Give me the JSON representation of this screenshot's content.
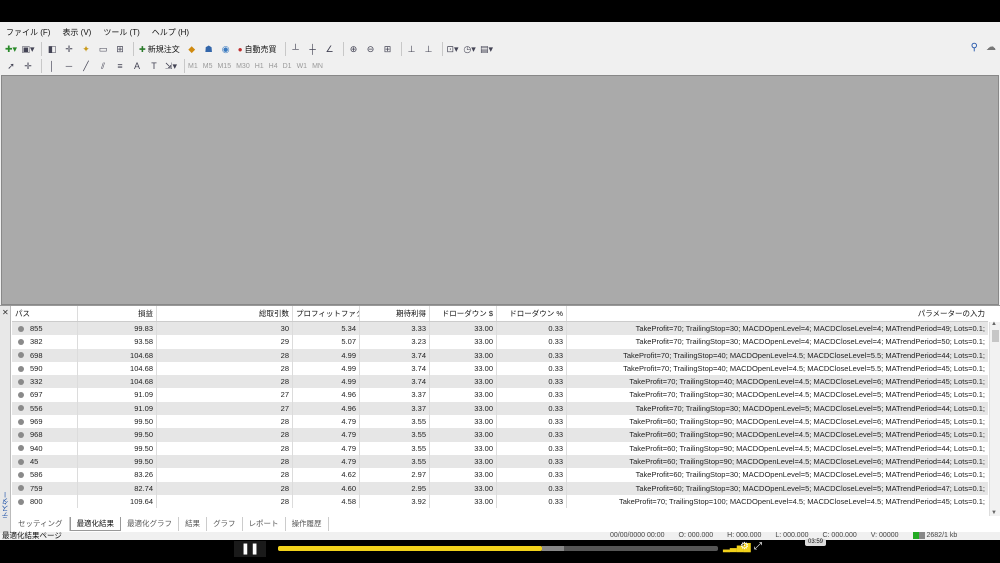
{
  "menu": [
    "ファイル (F)",
    "表示 (V)",
    "ツール (T)",
    "ヘルプ (H)"
  ],
  "toolbar": {
    "new_order": "新規注文",
    "auto_trade": "自動売買",
    "timeframes": [
      "M1",
      "M5",
      "M15",
      "M30",
      "H1",
      "H4",
      "D1",
      "W1",
      "MN"
    ]
  },
  "table": {
    "headers": {
      "pass": "パス",
      "profit": "損益",
      "trades": "総取引数",
      "pf": "プロフィットファク...",
      "ep": "期待利得",
      "dd": "ドローダウン $",
      "ddp": "ドローダウン %",
      "inputs": "パラメーターの入力"
    },
    "rows": [
      {
        "pass": "855",
        "profit": "99.83",
        "trades": "30",
        "pf": "5.34",
        "ep": "3.33",
        "dd": "33.00",
        "ddp": "0.33",
        "inputs": "TakeProfit=70; TrailingStop=30; MACDOpenLevel=4; MACDCloseLevel=4; MATrendPeriod=49; Lots=0.1;"
      },
      {
        "pass": "382",
        "profit": "93.58",
        "trades": "29",
        "pf": "5.07",
        "ep": "3.23",
        "dd": "33.00",
        "ddp": "0.33",
        "inputs": "TakeProfit=70; TrailingStop=30; MACDOpenLevel=4; MACDCloseLevel=4; MATrendPeriod=50; Lots=0.1;"
      },
      {
        "pass": "698",
        "profit": "104.68",
        "trades": "28",
        "pf": "4.99",
        "ep": "3.74",
        "dd": "33.00",
        "ddp": "0.33",
        "inputs": "TakeProfit=70; TrailingStop=40; MACDOpenLevel=4.5; MACDCloseLevel=5.5; MATrendPeriod=44; Lots=0.1;"
      },
      {
        "pass": "590",
        "profit": "104.68",
        "trades": "28",
        "pf": "4.99",
        "ep": "3.74",
        "dd": "33.00",
        "ddp": "0.33",
        "inputs": "TakeProfit=70; TrailingStop=40; MACDOpenLevel=4.5; MACDCloseLevel=5.5; MATrendPeriod=45; Lots=0.1;"
      },
      {
        "pass": "332",
        "profit": "104.68",
        "trades": "28",
        "pf": "4.99",
        "ep": "3.74",
        "dd": "33.00",
        "ddp": "0.33",
        "inputs": "TakeProfit=70; TrailingStop=40; MACDOpenLevel=4.5; MACDCloseLevel=6; MATrendPeriod=45; Lots=0.1;"
      },
      {
        "pass": "697",
        "profit": "91.09",
        "trades": "27",
        "pf": "4.96",
        "ep": "3.37",
        "dd": "33.00",
        "ddp": "0.33",
        "inputs": "TakeProfit=70; TrailingStop=30; MACDOpenLevel=4.5; MACDCloseLevel=5; MATrendPeriod=45; Lots=0.1;"
      },
      {
        "pass": "556",
        "profit": "91.09",
        "trades": "27",
        "pf": "4.96",
        "ep": "3.37",
        "dd": "33.00",
        "ddp": "0.33",
        "inputs": "TakeProfit=70; TrailingStop=30; MACDOpenLevel=5; MACDCloseLevel=5; MATrendPeriod=44; Lots=0.1;"
      },
      {
        "pass": "969",
        "profit": "99.50",
        "trades": "28",
        "pf": "4.79",
        "ep": "3.55",
        "dd": "33.00",
        "ddp": "0.33",
        "inputs": "TakeProfit=60; TrailingStop=90; MACDOpenLevel=4.5; MACDCloseLevel=6; MATrendPeriod=45; Lots=0.1;"
      },
      {
        "pass": "968",
        "profit": "99.50",
        "trades": "28",
        "pf": "4.79",
        "ep": "3.55",
        "dd": "33.00",
        "ddp": "0.33",
        "inputs": "TakeProfit=60; TrailingStop=90; MACDOpenLevel=4.5; MACDCloseLevel=5; MATrendPeriod=45; Lots=0.1;"
      },
      {
        "pass": "940",
        "profit": "99.50",
        "trades": "28",
        "pf": "4.79",
        "ep": "3.55",
        "dd": "33.00",
        "ddp": "0.33",
        "inputs": "TakeProfit=60; TrailingStop=90; MACDOpenLevel=4.5; MACDCloseLevel=5; MATrendPeriod=44; Lots=0.1;"
      },
      {
        "pass": "45",
        "profit": "99.50",
        "trades": "28",
        "pf": "4.79",
        "ep": "3.55",
        "dd": "33.00",
        "ddp": "0.33",
        "inputs": "TakeProfit=60; TrailingStop=90; MACDOpenLevel=4.5; MACDCloseLevel=6; MATrendPeriod=44; Lots=0.1;"
      },
      {
        "pass": "586",
        "profit": "83.26",
        "trades": "28",
        "pf": "4.62",
        "ep": "2.97",
        "dd": "33.00",
        "ddp": "0.33",
        "inputs": "TakeProfit=60; TrailingStop=30; MACDOpenLevel=5; MACDCloseLevel=5; MATrendPeriod=46; Lots=0.1;"
      },
      {
        "pass": "759",
        "profit": "82.74",
        "trades": "28",
        "pf": "4.60",
        "ep": "2.95",
        "dd": "33.00",
        "ddp": "0.33",
        "inputs": "TakeProfit=60; TrailingStop=30; MACDOpenLevel=5; MACDCloseLevel=5; MATrendPeriod=47; Lots=0.1;"
      },
      {
        "pass": "800",
        "profit": "109.64",
        "trades": "28",
        "pf": "4.58",
        "ep": "3.92",
        "dd": "33.00",
        "ddp": "0.33",
        "inputs": "TakeProfit=70; TrailingStop=100; MACDOpenLevel=4.5; MACDCloseLevel=4.5; MATrendPeriod=45; Lots=0.1;"
      }
    ]
  },
  "side_label": "テスター",
  "tabs": [
    "セッティング",
    "最適化結果",
    "最適化グラフ",
    "結果",
    "グラフ",
    "レポート",
    "操作履歴"
  ],
  "active_tab": "最適化結果",
  "status_text": "最適化結果ページ",
  "status_bar": {
    "datetime": "00/00/0000 00:00",
    "open": "O: 000.000",
    "high": "H: 000.000",
    "low": "L: 000.000",
    "close": "C: 000.000",
    "volume": "V: 00000",
    "traffic": "2682/1 kb"
  },
  "player": {
    "time_tip": "03:59",
    "progress_fraction": 0.6
  }
}
